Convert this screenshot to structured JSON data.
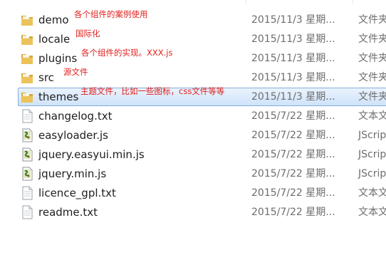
{
  "files": [
    {
      "name": "demo",
      "annotation": "各个组件的案例使用",
      "date": "2015/11/3 星期...",
      "type": "文件夹",
      "icon": "folder-icon"
    },
    {
      "name": "locale",
      "annotation": "国际化",
      "date": "2015/11/3 星期...",
      "type": "文件夹",
      "icon": "folder-icon"
    },
    {
      "name": "plugins",
      "annotation": "各个组件的实现。XXX.js",
      "date": "2015/11/3 星期...",
      "type": "文件夹",
      "icon": "folder-icon"
    },
    {
      "name": "src",
      "annotation": "源文件",
      "date": "2015/11/3 星期...",
      "type": "文件夹",
      "icon": "folder-icon"
    },
    {
      "name": "themes",
      "annotation": "主题文件，比如一些图标，css文件等等",
      "date": "2015/11/3 星期...",
      "type": "文件夹",
      "icon": "folder-icon",
      "selected": true
    },
    {
      "name": "changelog.txt",
      "annotation": "",
      "date": "2015/7/22 星期...",
      "type": "文本文",
      "icon": "text-file-icon"
    },
    {
      "name": "easyloader.js",
      "annotation": "",
      "date": "2015/7/22 星期...",
      "type": "JScrip",
      "icon": "script-file-icon"
    },
    {
      "name": "jquery.easyui.min.js",
      "annotation": "",
      "date": "2015/7/22 星期...",
      "type": "JScrip",
      "icon": "script-file-icon"
    },
    {
      "name": "jquery.min.js",
      "annotation": "",
      "date": "2015/7/22 星期...",
      "type": "JScrip",
      "icon": "script-file-icon"
    },
    {
      "name": "licence_gpl.txt",
      "annotation": "",
      "date": "2015/7/22 星期...",
      "type": "文本文",
      "icon": "text-file-icon"
    },
    {
      "name": "readme.txt",
      "annotation": "",
      "date": "2015/7/22 星期...",
      "type": "文本文",
      "icon": "text-file-icon"
    }
  ],
  "colors": {
    "annotation": "#e0201c",
    "selection_border": "#84acdd",
    "selection_fill": "#cfe3fa",
    "folder": "#e8c15a"
  }
}
